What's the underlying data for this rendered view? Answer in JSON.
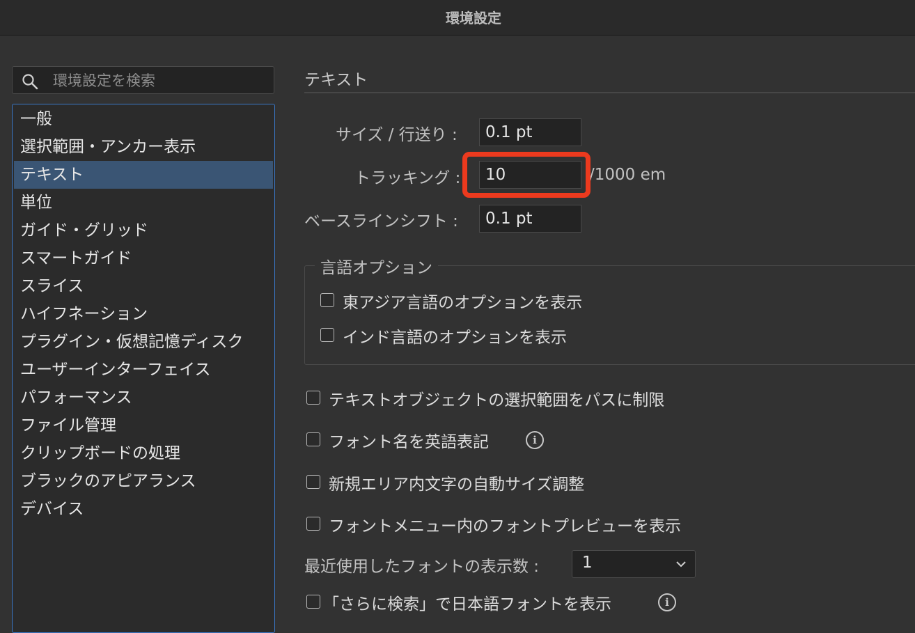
{
  "window": {
    "title": "環境設定"
  },
  "search": {
    "placeholder": "環境設定を検索"
  },
  "categories": [
    "一般",
    "選択範囲・アンカー表示",
    "テキスト",
    "単位",
    "ガイド・グリッド",
    "スマートガイド",
    "スライス",
    "ハイフネーション",
    "プラグイン・仮想記憶ディスク",
    "ユーザーインターフェイス",
    "パフォーマンス",
    "ファイル管理",
    "クリップボードの処理",
    "ブラックのアピアランス",
    "デバイス"
  ],
  "selected_category": "テキスト",
  "section": {
    "title": "テキスト"
  },
  "fields": {
    "size_leading": {
      "label": "サイズ / 行送り :",
      "value": "0.1 pt"
    },
    "tracking": {
      "label": "トラッキング :",
      "value": "10",
      "unit": "/1000 em"
    },
    "baseline_shift": {
      "label": "ベースラインシフト :",
      "value": "0.1 pt"
    }
  },
  "language_options": {
    "title": "言語オプション",
    "east_asian": {
      "label": "東アジア言語のオプションを表示",
      "checked": false
    },
    "indic": {
      "label": "インド言語のオプションを表示",
      "checked": false
    }
  },
  "checkboxes": {
    "restrict_to_path": {
      "label": "テキストオブジェクトの選択範囲をパスに制限",
      "checked": false
    },
    "font_names_english": {
      "label": "フォント名を英語表記",
      "checked": false
    },
    "auto_size_area": {
      "label": "新規エリア内文字の自動サイズ調整",
      "checked": false
    },
    "font_preview": {
      "label": "フォントメニュー内のフォントプレビューを表示",
      "checked": false
    },
    "japanese_fonts_more": {
      "label": "「さらに検索」で日本語フォントを表示",
      "checked": false
    }
  },
  "recent_fonts": {
    "label": "最近使用したフォントの表示数 :",
    "value": "1"
  },
  "colors": {
    "background": "#323232",
    "selection": "#3a5574",
    "list_border": "#3a78c8",
    "annotation": "#ec3a1e"
  },
  "icons": [
    "search-icon",
    "info-icon",
    "chevron-down-icon"
  ]
}
